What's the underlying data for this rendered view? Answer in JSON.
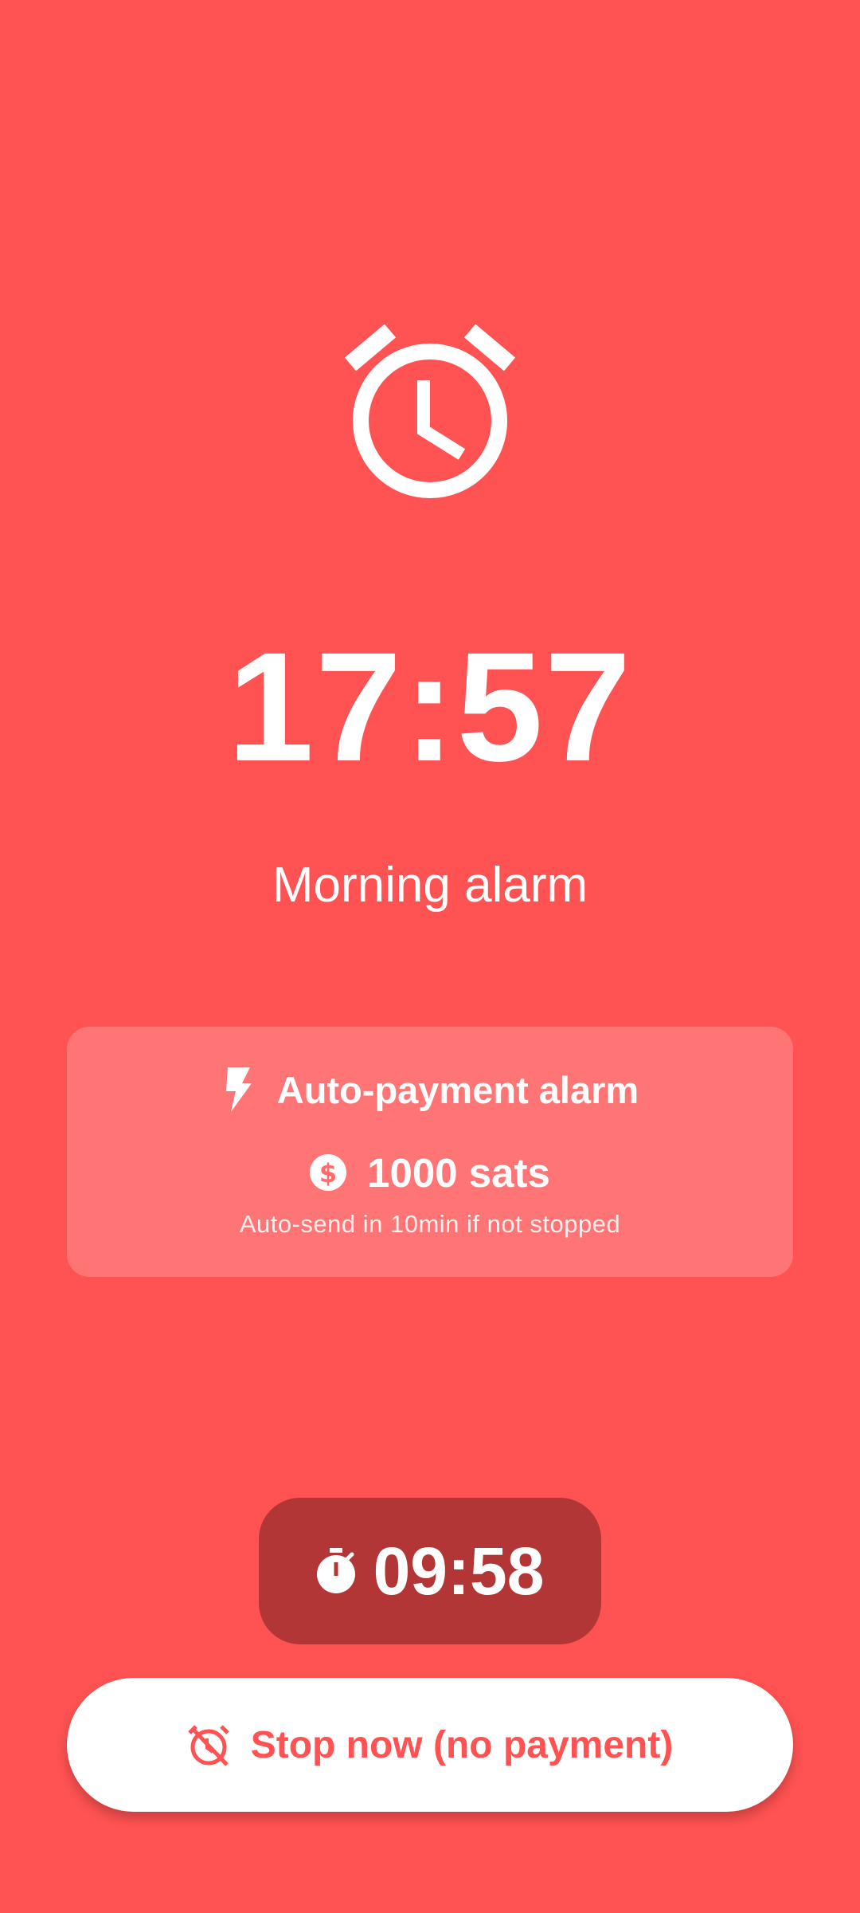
{
  "alarm": {
    "time": "17:57",
    "label": "Morning alarm"
  },
  "payment_card": {
    "title": "Auto-payment alarm",
    "amount": "1000 sats",
    "note": "Auto-send in 10min if not stopped",
    "title_icon": "bolt-icon",
    "amount_icon": "dollar-coin-icon"
  },
  "countdown": {
    "value": "09:58",
    "icon": "timer-icon"
  },
  "stop_button": {
    "label": "Stop now (no payment)",
    "icon": "alarm-off-icon"
  },
  "colors": {
    "background": "#FF5252",
    "card": "rgba(255,255,255,0.2)",
    "countdown_bg": "#B23636",
    "button_bg": "#FFFFFF",
    "button_text": "#FF5252"
  }
}
